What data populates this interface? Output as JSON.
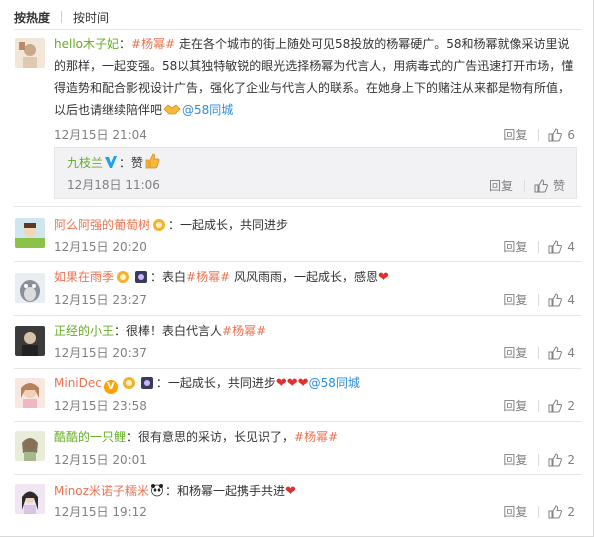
{
  "sort": {
    "hot": "按热度",
    "time": "按时间"
  },
  "actions": {
    "reply": "回复",
    "like_label": "赞"
  },
  "c1": {
    "user": "hello木子妃",
    "colon": "：",
    "tag": "#杨幂#",
    "text": " 走在各个城市的街上随处可见58投放的杨幂硬广。58和杨幂就像采访里说的那样，一起变强。58以其独特敏锐的眼光选择杨幂为代言人，用病毒式的广告迅速打开市场，懂得造势和配合影视设计广告，强化了企业与代言人的联系。在她身上下的赌注从来都是物有所值，以后也请继续陪伴吧",
    "mention": "@58同城",
    "time": "12月15日 21:04",
    "likes": "6"
  },
  "r1": {
    "user": "九枝兰",
    "text": "：赞",
    "time": "12月18日 11:06"
  },
  "c2": {
    "user": "阿么阿强的葡萄树",
    "text": "：一起成长，共同进步",
    "time": "12月15日 20:20",
    "likes": "4"
  },
  "c3": {
    "user": "如果在雨季",
    "text": "：表白",
    "tag": "#杨幂#",
    "text2": " 风风雨雨，一起成长，感恩",
    "time": "12月15日 23:27",
    "likes": "4"
  },
  "c4": {
    "user": "正经的小王",
    "text": "：很棒！表白代言人",
    "tag": "#杨幂#",
    "time": "12月15日 20:37",
    "likes": "4"
  },
  "c5": {
    "user": "MiniDec",
    "text": "：一起成长，共同进步",
    "mention": "@58同城",
    "time": "12月15日 23:58",
    "likes": "2"
  },
  "c6": {
    "user": "酷酷的一只鲤",
    "text": "：很有意思的采访，长见识了，",
    "tag": "#杨幂#",
    "time": "12月15日 20:01",
    "likes": "2"
  },
  "c7": {
    "user": "Minoz米诺子糯米",
    "text": "：和杨幂一起携手共进",
    "time": "12月15日 19:12",
    "likes": "2"
  },
  "colors": {
    "username": "#eb7350",
    "username_alt": "#64ae24",
    "mention": "#2d8ddc",
    "time": "#808080"
  },
  "icons": [
    "thumb-up-icon",
    "verified-badge-icon",
    "heart-emoji",
    "handshake-emoji",
    "panda-emoji",
    "medal-icon"
  ]
}
